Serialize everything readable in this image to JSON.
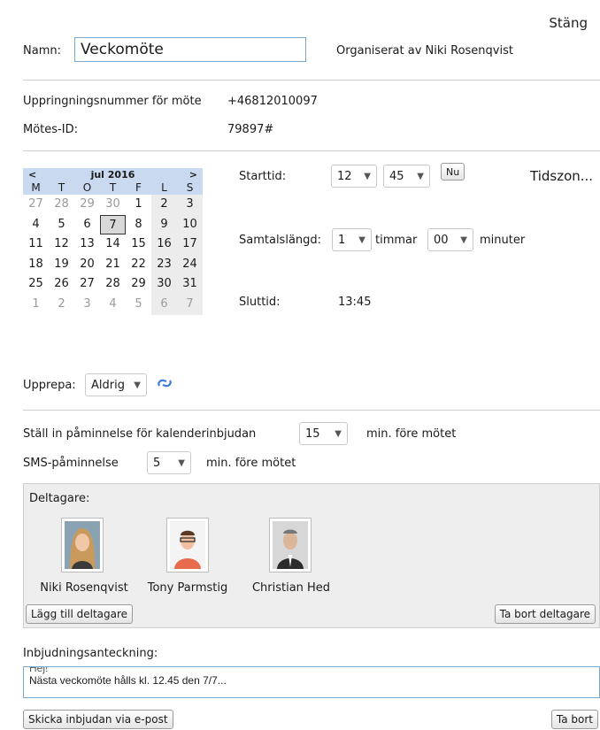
{
  "header": {
    "close_label": "Stäng"
  },
  "meeting": {
    "name_label": "Namn:",
    "name_value": "Veckomöte ",
    "organized_by": "Organiserat av Niki Rosenqvist",
    "dial_label": "Uppringningsnummer för möte",
    "dial_value": "+46812010097",
    "id_label": "Mötes-ID:",
    "id_value": "79897#"
  },
  "calendar": {
    "prev": "<",
    "next": ">",
    "month_label": "jul 2016",
    "weekdays": [
      "M",
      "T",
      "O",
      "T",
      "F",
      "L",
      "S"
    ],
    "weeks": [
      [
        "27",
        "28",
        "29",
        "30",
        "1",
        "2",
        "3"
      ],
      [
        "4",
        "5",
        "6",
        "7",
        "8",
        "9",
        "10"
      ],
      [
        "11",
        "12",
        "13",
        "14",
        "15",
        "16",
        "17"
      ],
      [
        "18",
        "19",
        "20",
        "21",
        "22",
        "23",
        "24"
      ],
      [
        "25",
        "26",
        "27",
        "28",
        "29",
        "30",
        "31"
      ],
      [
        "1",
        "2",
        "3",
        "4",
        "5",
        "6",
        "7"
      ]
    ],
    "selected": "7"
  },
  "time": {
    "start_label": "Starttid:",
    "start_hour": "12",
    "start_minute": "45",
    "now_label": "Nu",
    "timezone_label": "Tidszon...",
    "duration_label": "Samtalslängd:",
    "duration_hours": "1",
    "hours_unit": "timmar",
    "duration_minutes": "00",
    "minutes_unit": "minuter",
    "end_label": "Sluttid:",
    "end_value": "13:45"
  },
  "repeat": {
    "label": "Upprepa:",
    "value": "Aldrig"
  },
  "reminders": {
    "calendar_label": "Ställ in påminnelse för kalenderinbjudan",
    "calendar_value": "15",
    "calendar_suffix": "min. före mötet",
    "sms_label": "SMS-påminnelse",
    "sms_value": "5",
    "sms_suffix": "min. före mötet"
  },
  "participants": {
    "title": "Deltagare:",
    "people": [
      {
        "name": "Niki Rosenqvist"
      },
      {
        "name": "Tony Parmstig"
      },
      {
        "name": "Christian Hed"
      }
    ],
    "add_label": "Lägg till deltagare",
    "remove_label": "Ta bort deltagare"
  },
  "invitation": {
    "label": "Inbjudningsanteckning:",
    "line1": "Hej!",
    "line2": "Nästa veckomöte hålls kl. 12.45 den 7/7..."
  },
  "footer": {
    "send_label": "Skicka inbjudan via e-post",
    "delete_label": "Ta bort"
  },
  "colors": {
    "accent_border": "#7aa7cc",
    "calendar_header": "#c9daf0",
    "panel_bg": "#eeeeee"
  }
}
